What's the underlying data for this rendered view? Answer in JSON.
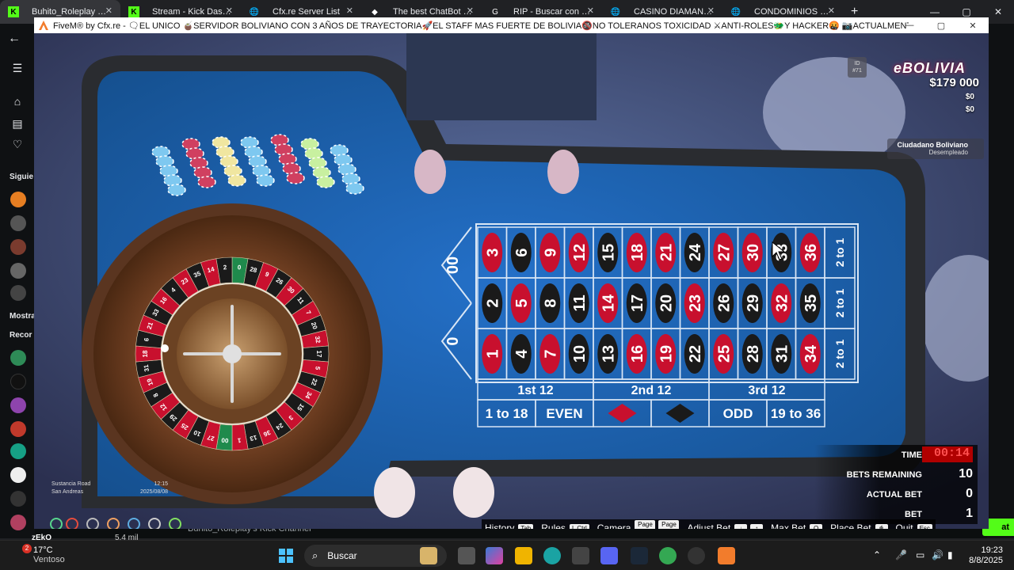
{
  "browser": {
    "tabs": [
      {
        "title": "Buhito_Roleplay Stre",
        "active": true
      },
      {
        "title": "Stream - Kick Dashb",
        "active": false
      },
      {
        "title": "Cfx.re Server List",
        "active": false
      },
      {
        "title": "The best ChatBot an",
        "active": false
      },
      {
        "title": "RIP - Buscar con Goo",
        "active": false
      },
      {
        "title": "CASINO DIAMANTE",
        "active": false
      },
      {
        "title": "CONDOMINIOS MIR",
        "active": false
      }
    ],
    "new_tab": "+",
    "minimize": "—",
    "maximize": "▢",
    "close": "✕"
  },
  "kick": {
    "sidebar_labels": [
      "Siguie",
      "Mostra",
      "Recor"
    ],
    "chat_button": "at",
    "channel_title": "Buhito_Roleplay's Kick Channel",
    "viewer_name": "zEkO",
    "viewer_count": "5.4 mil"
  },
  "fivem": {
    "title": "FiveM® by Cfx.re - 🗨EL UNICO 🧉SERVIDOR BOLIVIANO CON 3 AÑOS DE TRAYECTORIA🚀EL STAFF MAS FUERTE DE BOLIVIA🚳NO TOLERANOS TOXICIDAD ⚔ANTI-ROLES🐲Y HACKER🤬 📷ACTUALMENTE ESTAMOS EN NUESTRA EDIC...",
    "minimize": "—",
    "maximize": "▢",
    "close": "✕"
  },
  "roulette": {
    "zeros": [
      "00",
      "0"
    ],
    "rows": [
      [
        {
          "n": "3",
          "c": "red"
        },
        {
          "n": "6",
          "c": "black"
        },
        {
          "n": "9",
          "c": "red"
        },
        {
          "n": "12",
          "c": "red"
        },
        {
          "n": "15",
          "c": "black"
        },
        {
          "n": "18",
          "c": "red"
        },
        {
          "n": "21",
          "c": "red"
        },
        {
          "n": "24",
          "c": "black"
        },
        {
          "n": "27",
          "c": "red"
        },
        {
          "n": "30",
          "c": "red"
        },
        {
          "n": "33",
          "c": "black"
        },
        {
          "n": "36",
          "c": "red"
        }
      ],
      [
        {
          "n": "2",
          "c": "black"
        },
        {
          "n": "5",
          "c": "red"
        },
        {
          "n": "8",
          "c": "black"
        },
        {
          "n": "11",
          "c": "black"
        },
        {
          "n": "14",
          "c": "red"
        },
        {
          "n": "17",
          "c": "black"
        },
        {
          "n": "20",
          "c": "black"
        },
        {
          "n": "23",
          "c": "red"
        },
        {
          "n": "26",
          "c": "black"
        },
        {
          "n": "29",
          "c": "black"
        },
        {
          "n": "32",
          "c": "red"
        },
        {
          "n": "35",
          "c": "black"
        }
      ],
      [
        {
          "n": "1",
          "c": "red"
        },
        {
          "n": "4",
          "c": "black"
        },
        {
          "n": "7",
          "c": "red"
        },
        {
          "n": "10",
          "c": "black"
        },
        {
          "n": "13",
          "c": "black"
        },
        {
          "n": "16",
          "c": "red"
        },
        {
          "n": "19",
          "c": "red"
        },
        {
          "n": "22",
          "c": "black"
        },
        {
          "n": "25",
          "c": "red"
        },
        {
          "n": "28",
          "c": "black"
        },
        {
          "n": "31",
          "c": "black"
        },
        {
          "n": "34",
          "c": "red"
        }
      ]
    ],
    "columns": [
      "2 to 1",
      "2 to 1",
      "2 to 1"
    ],
    "dozens": [
      "1st 12",
      "2nd 12",
      "3rd 12"
    ],
    "outside": [
      "1 to 18",
      "EVEN",
      "",
      "",
      "ODD",
      "19 to 36"
    ],
    "wheel_numbers": [
      "0",
      "28",
      "9",
      "26",
      "30",
      "11",
      "7",
      "20",
      "32",
      "17",
      "5",
      "22",
      "34",
      "15",
      "3",
      "24",
      "36",
      "13",
      "1",
      "00",
      "27",
      "10",
      "25",
      "29",
      "12",
      "8",
      "19",
      "31",
      "18",
      "6",
      "21",
      "33",
      "16",
      "4",
      "23",
      "35",
      "14",
      "2"
    ]
  },
  "hud": {
    "id_label": "ID",
    "id_value": "#71",
    "server_logo": "eBOLIVIA",
    "cash": "$179 000",
    "bank": "$0",
    "dirty": "$0",
    "job_title": "Ciudadano Boliviano",
    "job_status": "Desempleado",
    "street": "Sustancia Road",
    "area": "San Andreas",
    "time": "12:15",
    "date": "2025/08/08"
  },
  "stats": {
    "time_label": "TIME",
    "time_value": "00:14",
    "bets_remaining_label": "BETS REMAINING",
    "bets_remaining_value": "10",
    "actual_bet_label": "ACTUAL BET",
    "actual_bet_value": "0",
    "bet_label": "BET",
    "bet_value": "1"
  },
  "controls": [
    {
      "label": "History",
      "key": "Tab"
    },
    {
      "label": "Rules",
      "key": "L Ctrl"
    },
    {
      "label": "Camera",
      "key": "Page Down"
    },
    {
      "label": "",
      "key": "Page Up"
    },
    {
      "label": "Adjust Bet",
      "key": "↓"
    },
    {
      "label": "",
      "key": "↑"
    },
    {
      "label": "Max Bet",
      "key": "Q"
    },
    {
      "label": "Place Bet",
      "key": "🖱"
    },
    {
      "label": "Quit",
      "key": "Esc"
    }
  ],
  "taskbar": {
    "temperature": "17°C",
    "weather": "Ventoso",
    "weather_badge": "2",
    "search_placeholder": "Buscar",
    "clock_time": "19:23",
    "clock_date": "8/8/2025"
  },
  "colors": {
    "felt": "#1f63b6",
    "felt_dark": "#164f96",
    "red_cell": "#c8102e",
    "black_cell": "#1a1a1a",
    "wood": "#6b3b20",
    "kick_green": "#53fc18"
  }
}
